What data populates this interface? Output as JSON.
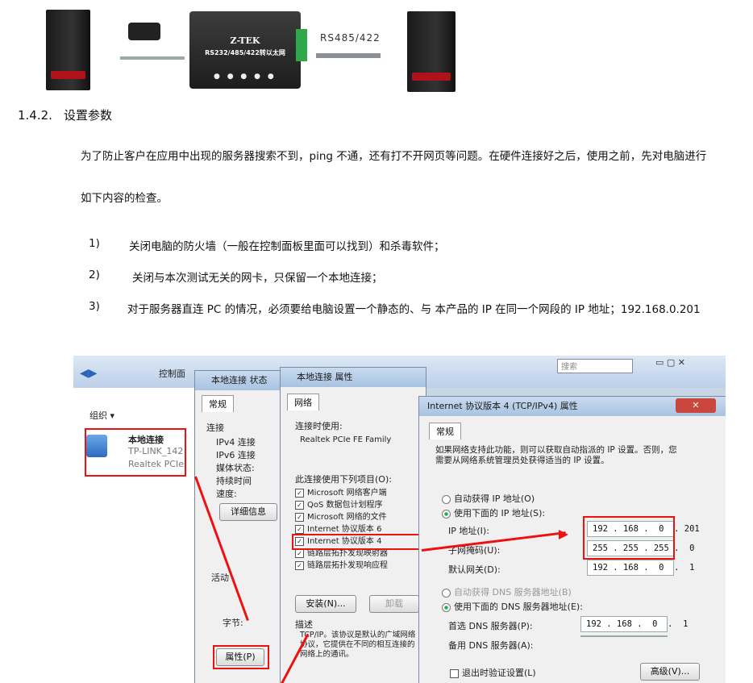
{
  "diagram": {
    "device_brand": "Z-TEK",
    "device_model": "RS232/485/422转以太网",
    "link_label": "RS485/422"
  },
  "section": {
    "number": "1.4.2.",
    "title": "设置参数"
  },
  "intro": {
    "line1": "为了防止客户在应用中出现的服务器搜索不到，ping 不通，还有打不开网页等问题。在硬件连接好之后，使用之前，先对电脑进行",
    "line2": "如下内容的检查。"
  },
  "steps": [
    {
      "num": "1)",
      "text": "关闭电脑的防火墙（一般在控制面板里面可以找到）和杀毒软件；"
    },
    {
      "num": "2)",
      "text": "关闭与本次测试无关的网卡，只保留一个本地连接；"
    },
    {
      "num": "3)",
      "text": "对于服务器直连 PC 的情况，必须要给电脑设置一个静态的、与 本产品的 IP 在同一个网段的 IP 地址；192.168.0.201"
    }
  ],
  "screenshot": {
    "explorer": {
      "breadcrumb": "控制面",
      "organize": "组织 ▾",
      "conn_name": "本地连接",
      "conn_net": "TP-LINK_142",
      "conn_adapter": "Realtek PCIe"
    },
    "status_win": {
      "title": "本地连接 状态",
      "tab": "常规",
      "group": "连接",
      "rows": [
        "IPv4 连接",
        "IPv6 连接",
        "媒体状态:",
        "持续时间",
        "速度:"
      ],
      "details_btn": "详细信息",
      "activity": "活动",
      "bytes": "字节:",
      "properties_btn": "属性(P)"
    },
    "props_win": {
      "title": "本地连接 属性",
      "tab": "网络",
      "connect_using": "连接时使用:",
      "adapter": "Realtek PCIe FE Family",
      "items_label": "此连接使用下列项目(O):",
      "items": [
        "Microsoft 网络客户端",
        "QoS 数据包计划程序",
        "Microsoft 网络的文件",
        "Internet 协议版本 6",
        "Internet 协议版本 4",
        "链路层拓扑发现映射器",
        "链路层拓扑发现响应程"
      ],
      "install_btn": "安装(N)...",
      "uninstall_btn": "卸载",
      "desc_label": "描述",
      "desc_text": "TCP/IP。该协议是默认的广域网络协议，它提供在不同的相互连接的网络上的通讯。"
    },
    "ipv4_win": {
      "title": "Internet 协议版本 4 (TCP/IPv4) 属性",
      "tab": "常规",
      "info": "如果网络支持此功能，则可以获取自动指派的 IP 设置。否则，您需要从网络系统管理员处获得适当的 IP 设置。",
      "auto_ip": "自动获得 IP 地址(O)",
      "manual_ip": "使用下面的 IP 地址(S):",
      "ip_label": "IP 地址(I):",
      "ip_value": "192 . 168 .  0  . 201",
      "mask_label": "子网掩码(U):",
      "mask_value": "255 . 255 . 255 .  0",
      "gw_label": "默认网关(D):",
      "gw_value": "192 . 168 .  0  .  1",
      "auto_dns": "自动获得 DNS 服务器地址(B)",
      "manual_dns": "使用下面的 DNS 服务器地址(E):",
      "dns1_label": "首选 DNS 服务器(P):",
      "dns1_value": "192 . 168 .  0  .  1",
      "dns2_label": "备用 DNS 服务器(A):",
      "validate": "退出时验证设置(L)",
      "advanced_btn": "高级(V)..."
    },
    "search_hint": "搜索",
    "colors": {
      "highlight": "#e11111"
    }
  }
}
